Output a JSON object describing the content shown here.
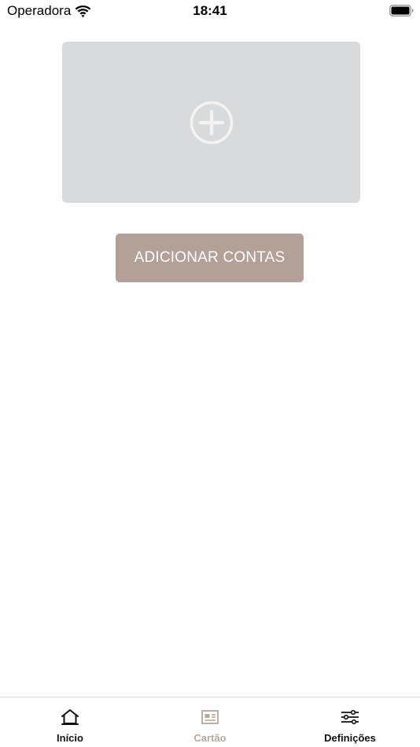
{
  "status_bar": {
    "carrier": "Operadora",
    "time": "18:41"
  },
  "main": {
    "add_button_label": "ADICIONAR CONTAS"
  },
  "tab_bar": {
    "tabs": [
      {
        "label": "Início",
        "icon": "home-icon",
        "active": true
      },
      {
        "label": "Cartão",
        "icon": "card-icon",
        "active": false
      },
      {
        "label": "Definições",
        "icon": "sliders-icon",
        "active": false
      }
    ]
  },
  "colors": {
    "card_background": "#d8dadb",
    "button_background": "#b3a097",
    "inactive_tab": "#b7a89f"
  }
}
